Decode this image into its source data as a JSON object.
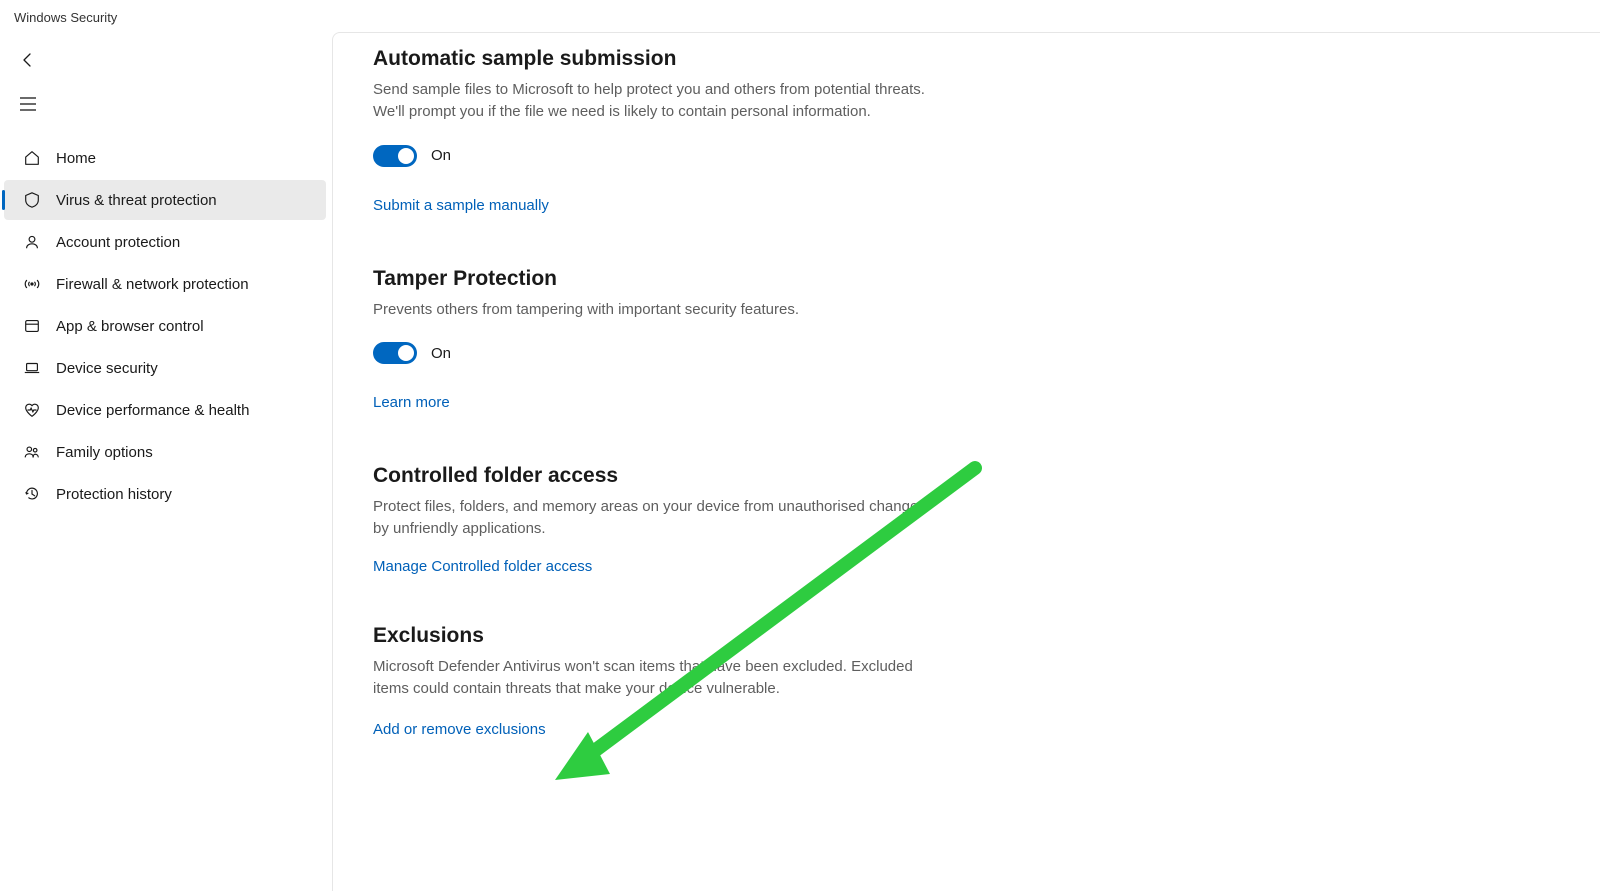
{
  "app": {
    "title": "Windows Security"
  },
  "sidebar": {
    "items": [
      {
        "label": "Home"
      },
      {
        "label": "Virus & threat protection"
      },
      {
        "label": "Account protection"
      },
      {
        "label": "Firewall & network protection"
      },
      {
        "label": "App & browser control"
      },
      {
        "label": "Device security"
      },
      {
        "label": "Device performance & health"
      },
      {
        "label": "Family options"
      },
      {
        "label": "Protection history"
      }
    ]
  },
  "sections": {
    "sample": {
      "title": "Automatic sample submission",
      "desc": "Send sample files to Microsoft to help protect you and others from potential threats. We'll prompt you if the file we need is likely to contain personal information.",
      "toggle_state": "On",
      "link": "Submit a sample manually"
    },
    "tamper": {
      "title": "Tamper Protection",
      "desc": "Prevents others from tampering with important security features.",
      "toggle_state": "On",
      "link": "Learn more"
    },
    "cfa": {
      "title": "Controlled folder access",
      "desc": "Protect files, folders, and memory areas on your device from unauthorised changes by unfriendly applications.",
      "link": "Manage Controlled folder access"
    },
    "exclusions": {
      "title": "Exclusions",
      "desc": "Microsoft Defender Antivirus won't scan items that have been excluded. Excluded items could contain threats that make your device vulnerable.",
      "link": "Add or remove exclusions"
    }
  },
  "annotation": {
    "arrow_color": "#2ecc40"
  }
}
